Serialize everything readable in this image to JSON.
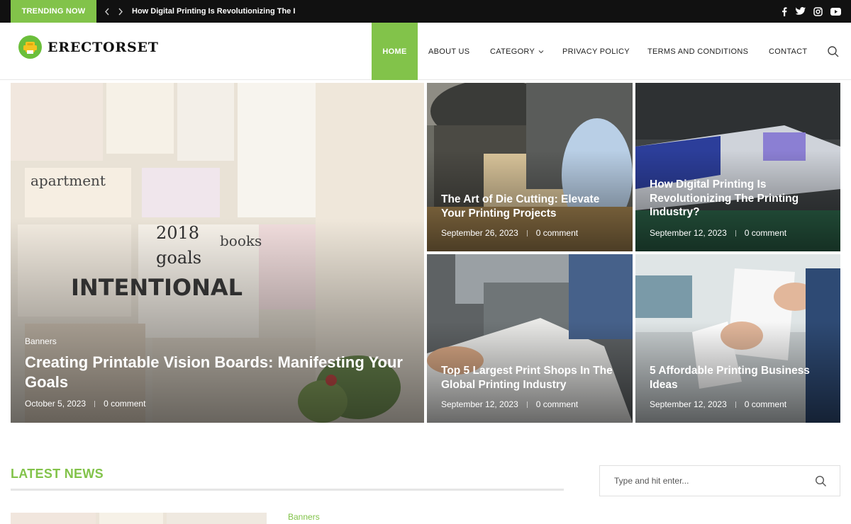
{
  "topbar": {
    "trending_label": "TRENDING NOW",
    "trending_title": "How Digital Printing Is Revolutionizing The I",
    "prev_icon": "chevron-left-icon",
    "next_icon": "chevron-right-icon",
    "social": [
      "facebook-icon",
      "twitter-icon",
      "instagram-icon",
      "youtube-icon"
    ]
  },
  "header": {
    "logo_text": "ERECTORSET",
    "nav": [
      "HOME",
      "ABOUT US",
      "CATEGORY",
      "PRIVACY POLICY",
      "TERMS AND CONDITIONS",
      "CONTACT"
    ],
    "search_icon": "search-icon"
  },
  "posts": [
    {
      "category": "Banners",
      "title": "Creating Printable Vision Boards: Manifesting Your Goals",
      "date": "October 5, 2023",
      "comments": "0 comment"
    },
    {
      "title": "The Art of Die Cutting: Elevate Your Printing Projects",
      "date": "September 26, 2023",
      "comments": "0 comment"
    },
    {
      "title": "How Digital Printing Is Revolutionizing The Printing Industry?",
      "date": "September 12, 2023",
      "comments": "0 comment"
    },
    {
      "title": "Top 5 Largest Print Shops In The Global Printing Industry",
      "date": "September 12, 2023",
      "comments": "0 comment"
    },
    {
      "title": "5 Affordable Printing Business Ideas",
      "date": "September 12, 2023",
      "comments": "0 comment"
    }
  ],
  "latest": {
    "heading": "LATEST NEWS",
    "first_category": "Banners"
  },
  "sidebar": {
    "search_placeholder": "Type and hit enter..."
  },
  "colors": {
    "accent": "#82c34a",
    "topbar": "#111111"
  }
}
